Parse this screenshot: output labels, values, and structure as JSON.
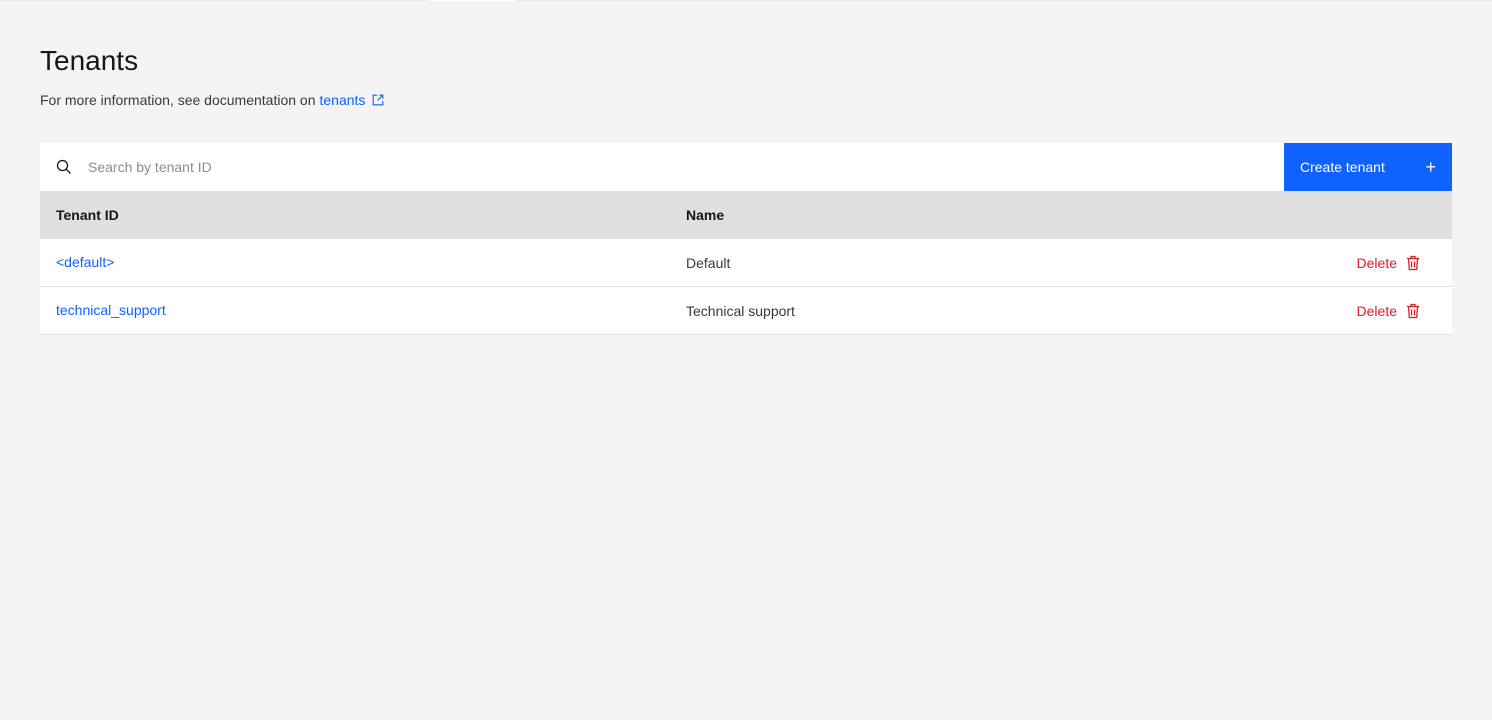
{
  "header": {
    "title": "Tenants",
    "subtitle_text": "For more information, see documentation on",
    "doc_link_label": "tenants",
    "doc_link_icon": "launch-icon"
  },
  "toolbar": {
    "search_placeholder": "Search by tenant ID",
    "search_value": "",
    "search_icon": "search-icon",
    "create_label": "Create tenant",
    "create_icon": "plus-icon"
  },
  "table": {
    "columns": [
      "Tenant ID",
      "Name"
    ],
    "rows": [
      {
        "tenant_id": "<default>",
        "name": "Default",
        "action_label": "Delete"
      },
      {
        "tenant_id": "technical_support",
        "name": "Technical support",
        "action_label": "Delete"
      }
    ]
  },
  "colors": {
    "primary": "#0f62fe",
    "danger": "#da1e28",
    "background": "#f4f4f4",
    "header_row": "#e0e0e0"
  }
}
